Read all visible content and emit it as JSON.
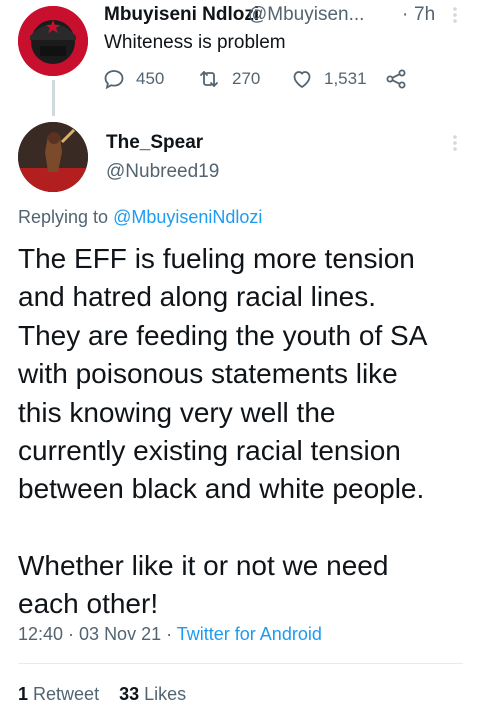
{
  "parent_tweet": {
    "author_name": "Mbuyiseni Ndlozi",
    "author_handle": "@Mbuyisen...",
    "separator": "·",
    "time": "7h",
    "text": "Whiteness is problem",
    "replies": "450",
    "retweets": "270",
    "likes": "1,531"
  },
  "main_tweet": {
    "author_name": "The_Spear",
    "author_handle": "@Nubreed19",
    "replying_prefix": "Replying to",
    "replying_to": "@MbuyiseniNdlozi",
    "lines": [
      "The EFF is fueling more tension",
      "and hatred along racial lines.",
      "They are feeding the youth of SA",
      "with poisonous statements like",
      "this knowing very well the",
      "currently existing racial tension",
      "between black and white people."
    ],
    "lines2": [
      "Whether like it or not we need",
      "each other!"
    ],
    "timestamp": "12:40 · 03 Nov 21 ·",
    "source": "Twitter for Android",
    "retweet_count": "1",
    "retweet_label": "Retweet",
    "like_count": "33",
    "like_label": "Likes"
  },
  "colors": {
    "text": "#0f1419",
    "secondary": "#536471",
    "link": "#1d9bf0",
    "border": "#cfd9de"
  },
  "icons": [
    "more-vertical-icon",
    "reply-icon",
    "retweet-icon",
    "like-icon",
    "share-icon"
  ]
}
